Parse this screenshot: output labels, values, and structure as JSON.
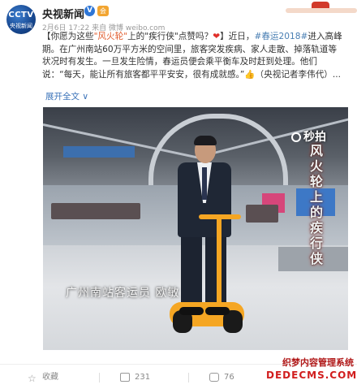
{
  "header": {
    "avatar_top": "CCTV",
    "avatar_bottom": "央视新闻",
    "author": "央视新闻",
    "verified_badge": "V",
    "level_badge": "会",
    "meta": "2月6日 17:22 来自 微博 weibo.com"
  },
  "post": {
    "line1_a": "【你愿为这些",
    "line1_hl": "\"风火轮\"",
    "line1_b": "上的\"疾行侠\"点赞吗？",
    "line1_heart": "❤",
    "line1_c": "】近日，",
    "hashtag": "#春运2018#",
    "line1_d": "进入高峰期。在广州南站60万平方米的空间里，旅客突发疾病、家人走散、掉落轨道等状况时有发生。一旦发生险情，春运员便会乘平衡车及时赶到处理。他们说：“每天，能让所有旅客都平平安安，很有成就感。”",
    "thumb": "👍",
    "line1_e": "（央视记者李伟代）...",
    "expand": "展开全文 ∨"
  },
  "video": {
    "watermark": "秒拍",
    "vertical_text": "风火轮上的疾行侠",
    "caption": "广州南站客运员 欧敏"
  },
  "actions": {
    "favorite": "收藏",
    "share": "231",
    "comment": "76"
  },
  "site_watermark": {
    "line1": "织梦内容管理系统",
    "line2": "DEDECMS.COM"
  }
}
